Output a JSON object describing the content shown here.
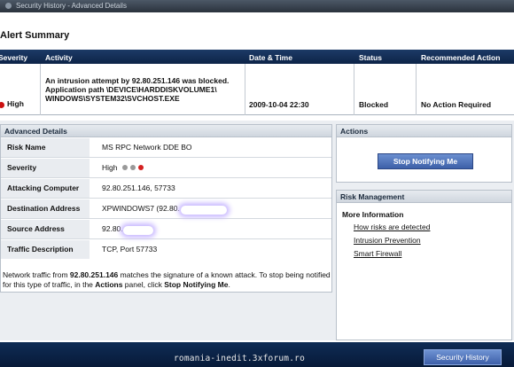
{
  "window": {
    "title": "Security History - Advanced Details"
  },
  "page": {
    "title": "Alert Summary"
  },
  "alert_table": {
    "columns": [
      "Severity",
      "Activity",
      "Date & Time",
      "Status",
      "Recommended Action"
    ],
    "row": {
      "severity": "High",
      "activity_lines": [
        "An intrusion attempt by 92.80.251.146 was blocked.",
        "Application path \\DEVICE\\HARDDISKVOLUME1\\",
        "WINDOWS\\SYSTEM32\\SVCHOST.EXE"
      ],
      "datetime": "2009-10-04 22:30",
      "status": "Blocked",
      "action": "No Action Required"
    }
  },
  "advanced": {
    "title": "Advanced Details",
    "rows": [
      {
        "label": "Risk Name",
        "value": "MS RPC Network DDE BO"
      },
      {
        "label": "Severity",
        "value": "High"
      },
      {
        "label": "Attacking Computer",
        "value": "92.80.251.146, 57733"
      },
      {
        "label": "Destination Address",
        "value": "XPWINDOWS7 (92.80."
      },
      {
        "label": "Source Address",
        "value": "92.80."
      },
      {
        "label": "Traffic Description",
        "value": "TCP, Port 57733"
      }
    ],
    "severity_dots": [
      "#999999",
      "#999999",
      "#d42020"
    ],
    "description": {
      "p1": "Network traffic from ",
      "ip": "92.80.251.146",
      "p2": " matches the signature of a known attack. To stop being notified for this type of traffic, in the ",
      "actions": "Actions",
      "p3": " panel, click ",
      "stop": "Stop Notifying Me",
      "p4": "."
    }
  },
  "actions": {
    "title": "Actions",
    "stop_button": "Stop Notifying Me"
  },
  "risk_management": {
    "title": "Risk Management",
    "more_info": "More Information",
    "links": [
      "How risks are detected",
      "Intrusion Prevention",
      "Smart Firewall"
    ]
  },
  "footer": {
    "history_button": "Security History",
    "watermark": "romania-inedit.3xforum.ro"
  }
}
